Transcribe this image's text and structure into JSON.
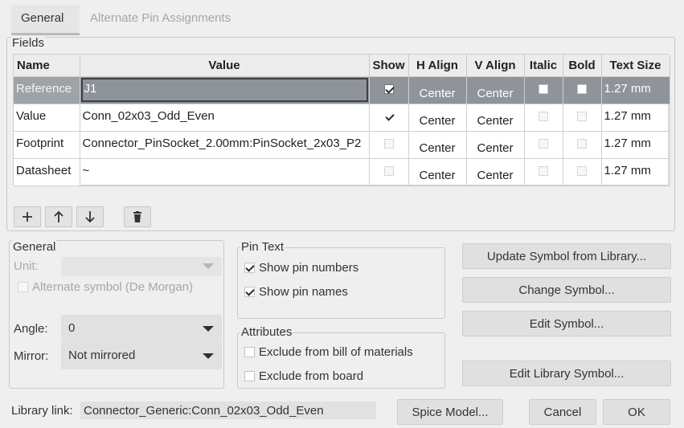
{
  "tabs": [
    {
      "label": "General",
      "active": true
    },
    {
      "label": "Alternate Pin Assignments",
      "active": false
    }
  ],
  "fields_group": {
    "label": "Fields",
    "columns": [
      "Name",
      "Value",
      "Show",
      "H Align",
      "V Align",
      "Italic",
      "Bold",
      "Text Size"
    ],
    "rows": [
      {
        "name": "Reference",
        "value": "J1",
        "show": true,
        "h_align": "Center",
        "v_align": "Center",
        "italic": false,
        "bold": false,
        "text_size": "1.27 mm",
        "selected": true
      },
      {
        "name": "Value",
        "value": "Conn_02x03_Odd_Even",
        "show": true,
        "h_align": "Center",
        "v_align": "Center",
        "italic": false,
        "bold": false,
        "text_size": "1.27 mm",
        "selected": false
      },
      {
        "name": "Footprint",
        "value": "Connector_PinSocket_2.00mm:PinSocket_2x03_P2",
        "show": false,
        "h_align": "Center",
        "v_align": "Center",
        "italic": false,
        "bold": false,
        "text_size": "1.27 mm",
        "selected": false
      },
      {
        "name": "Datasheet",
        "value": "~",
        "show": false,
        "h_align": "Center",
        "v_align": "Center",
        "italic": false,
        "bold": false,
        "text_size": "1.27 mm",
        "selected": false
      }
    ],
    "toolbar": {
      "add_icon": "plus-icon",
      "up_icon": "arrow-up-icon",
      "down_icon": "arrow-down-icon",
      "delete_icon": "trash-icon"
    }
  },
  "general_group": {
    "label": "General",
    "unit_label": "Unit:",
    "unit_value": "",
    "alternate_symbol_label": "Alternate symbol (De Morgan)",
    "alternate_symbol_checked": false,
    "angle_label": "Angle:",
    "angle_value": "0",
    "mirror_label": "Mirror:",
    "mirror_value": "Not mirrored"
  },
  "pin_text_group": {
    "label": "Pin Text",
    "show_pin_numbers_label": "Show pin numbers",
    "show_pin_numbers_checked": true,
    "show_pin_names_label": "Show pin names",
    "show_pin_names_checked": true
  },
  "attributes_group": {
    "label": "Attributes",
    "exclude_bom_label": "Exclude from bill of materials",
    "exclude_bom_checked": false,
    "exclude_board_label": "Exclude from board",
    "exclude_board_checked": false
  },
  "action_buttons": {
    "update_symbol": "Update Symbol from Library...",
    "change_symbol": "Change Symbol...",
    "edit_symbol": "Edit Symbol...",
    "edit_library_symbol": "Edit Library Symbol..."
  },
  "footer": {
    "library_link_label": "Library link:",
    "library_link_value": "Connector_Generic:Conn_02x03_Odd_Even",
    "spice_model": "Spice Model...",
    "cancel": "Cancel",
    "ok": "OK"
  },
  "colors": {
    "background": "#efefef",
    "selected_row": "#8f949a",
    "button": "#e0e0e0"
  }
}
